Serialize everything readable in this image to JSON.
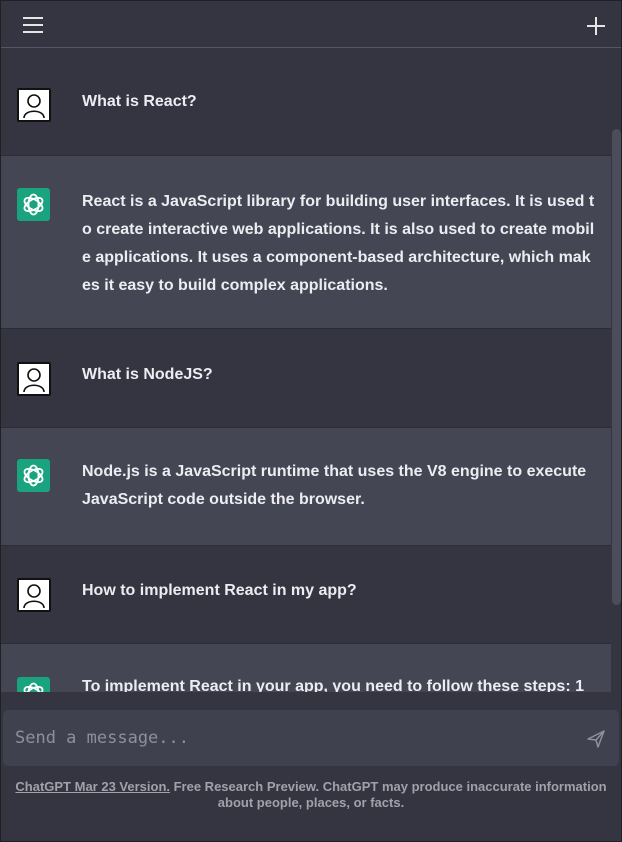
{
  "header": {
    "menu_icon": "hamburger-menu-icon",
    "new_chat_icon": "plus-icon"
  },
  "messages": [
    {
      "role": "user",
      "text": "What is React?"
    },
    {
      "role": "assistant",
      "text": "React is a JavaScript library for building user interfaces. It is used to create interactive web applications. It is also used to create mobile applications. It uses a component-based architecture, which makes it easy to build complex applications."
    },
    {
      "role": "user",
      "text": "What is NodeJS?"
    },
    {
      "role": "assistant",
      "text": "Node.js is a JavaScript runtime that uses the V8 engine to execute JavaScript code outside the browser."
    },
    {
      "role": "user",
      "text": "How to implement React in my app?"
    },
    {
      "role": "assistant",
      "text": "To implement React in your app, you need to follow these steps: 1"
    }
  ],
  "composer": {
    "placeholder": "Send a message...",
    "value": ""
  },
  "footer": {
    "version_link": "ChatGPT Mar 23 Version.",
    "disclaimer": " Free Research Preview. ChatGPT may produce inaccurate information about people, places, or facts."
  },
  "colors": {
    "background": "#343541",
    "assistant_row": "#444654",
    "input": "#40414f",
    "assistant_avatar": "#19a37f"
  }
}
